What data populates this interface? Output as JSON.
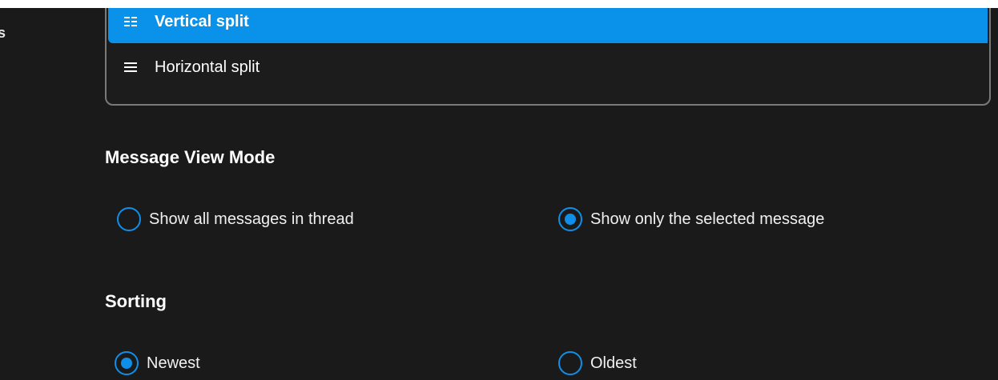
{
  "sidebar_fragment": {
    "text": "s"
  },
  "layout_options": {
    "items": [
      {
        "label": "Vertical split",
        "icon": "vertical-split-icon",
        "selected": true
      },
      {
        "label": "Horizontal split",
        "icon": "horizontal-split-icon",
        "selected": false
      }
    ],
    "accent_color": "#0a91ea"
  },
  "message_view_mode": {
    "title": "Message View Mode",
    "options": [
      {
        "label": "Show all messages in thread",
        "checked": false
      },
      {
        "label": "Show only the selected message",
        "checked": true
      }
    ]
  },
  "sorting": {
    "title": "Sorting",
    "options": [
      {
        "label": "Newest",
        "checked": true
      },
      {
        "label": "Oldest",
        "checked": false
      }
    ]
  }
}
